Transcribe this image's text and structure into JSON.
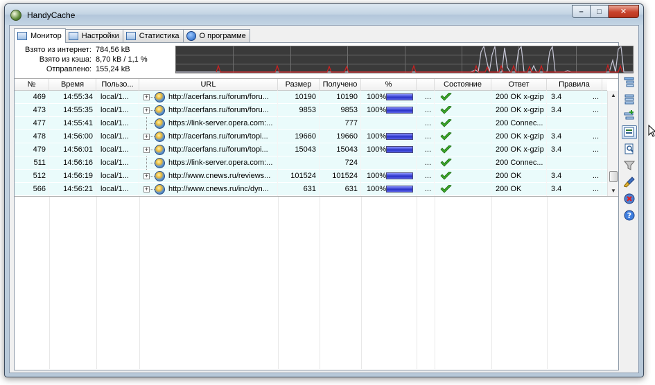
{
  "window": {
    "title": "HandyCache",
    "controls": {
      "minimize": "–",
      "maximize": "□",
      "close": "✕"
    }
  },
  "tabs": [
    {
      "label": "Монитор",
      "icon": "grid-icon",
      "active": true
    },
    {
      "label": "Настройки",
      "icon": "settings-list-icon",
      "active": false
    },
    {
      "label": "Статистика",
      "icon": "statistics-icon",
      "active": false
    },
    {
      "label": "О программе",
      "icon": "info-icon",
      "active": false
    }
  ],
  "stats": {
    "internet_label": "Взято из интернет:",
    "internet_value": "784,56 kB",
    "cache_label": "Взято из кэша:",
    "cache_value": "8,70 kB / 1,1 %",
    "sent_label": "Отправлено:",
    "sent_value": "155,24 kB"
  },
  "table": {
    "columns": [
      "№",
      "Время",
      "Пользо...",
      "URL",
      "Размер",
      "Получено",
      "%",
      "",
      "Состояние",
      "Ответ",
      "Правила"
    ],
    "rows": [
      {
        "num": "469",
        "time": "14:55:34",
        "user": "local/1...",
        "url": "http://acerfans.ru/forum/foru...",
        "size": "10190",
        "received": "10190",
        "percent_text": "100%",
        "percent": 100,
        "extra": "...",
        "response": "200 OK x-gzip",
        "rules": "3.4",
        "rules_more": "...",
        "expandable": true
      },
      {
        "num": "473",
        "time": "14:55:35",
        "user": "local/1...",
        "url": "http://acerfans.ru/forum/foru...",
        "size": "9853",
        "received": "9853",
        "percent_text": "100%",
        "percent": 100,
        "extra": "...",
        "response": "200 OK x-gzip",
        "rules": "3.4",
        "rules_more": "...",
        "expandable": true
      },
      {
        "num": "477",
        "time": "14:55:41",
        "user": "local/1...",
        "url": "https://link-server.opera.com:...",
        "size": "",
        "received": "777",
        "percent_text": "",
        "percent": 0,
        "extra": "...",
        "response": "200 Connec...",
        "rules": "",
        "rules_more": "",
        "expandable": false
      },
      {
        "num": "478",
        "time": "14:56:00",
        "user": "local/1...",
        "url": "http://acerfans.ru/forum/topi...",
        "size": "19660",
        "received": "19660",
        "percent_text": "100%",
        "percent": 100,
        "extra": "...",
        "response": "200 OK x-gzip",
        "rules": "3.4",
        "rules_more": "...",
        "expandable": true
      },
      {
        "num": "479",
        "time": "14:56:01",
        "user": "local/1...",
        "url": "http://acerfans.ru/forum/topi...",
        "size": "15043",
        "received": "15043",
        "percent_text": "100%",
        "percent": 100,
        "extra": "...",
        "response": "200 OK x-gzip",
        "rules": "3.4",
        "rules_more": "...",
        "expandable": true
      },
      {
        "num": "511",
        "time": "14:56:16",
        "user": "local/1...",
        "url": "https://link-server.opera.com:...",
        "size": "",
        "received": "724",
        "percent_text": "",
        "percent": 0,
        "extra": "...",
        "response": "200 Connec...",
        "rules": "",
        "rules_more": "",
        "expandable": false
      },
      {
        "num": "512",
        "time": "14:56:19",
        "user": "local/1...",
        "url": "http://www.cnews.ru/reviews...",
        "size": "101524",
        "received": "101524",
        "percent_text": "100%",
        "percent": 100,
        "extra": "...",
        "response": "200 OK",
        "rules": "3.4",
        "rules_more": "...",
        "expandable": true
      },
      {
        "num": "566",
        "time": "14:56:21",
        "user": "local/1...",
        "url": "http://www.cnews.ru/inc/dyn...",
        "size": "631",
        "received": "631",
        "percent_text": "100%",
        "percent": 100,
        "extra": "...",
        "response": "200 OK",
        "rules": "3.4",
        "rules_more": "...",
        "expandable": true
      }
    ]
  },
  "colors": {
    "row_bg": "#eafbfb",
    "graph_bg": "#3a3a3a",
    "graph_line": "#c8c8d8",
    "graph_spike": "#d02020",
    "progress": "#2a33c8",
    "check": "#3aa82a"
  },
  "side_tools": [
    "tree-view-icon",
    "list-view-icon",
    "add-tree-icon",
    "active-view-icon",
    "find-icon",
    "filter-icon",
    "clear-brush-icon",
    "delete-icon",
    "help-icon"
  ]
}
